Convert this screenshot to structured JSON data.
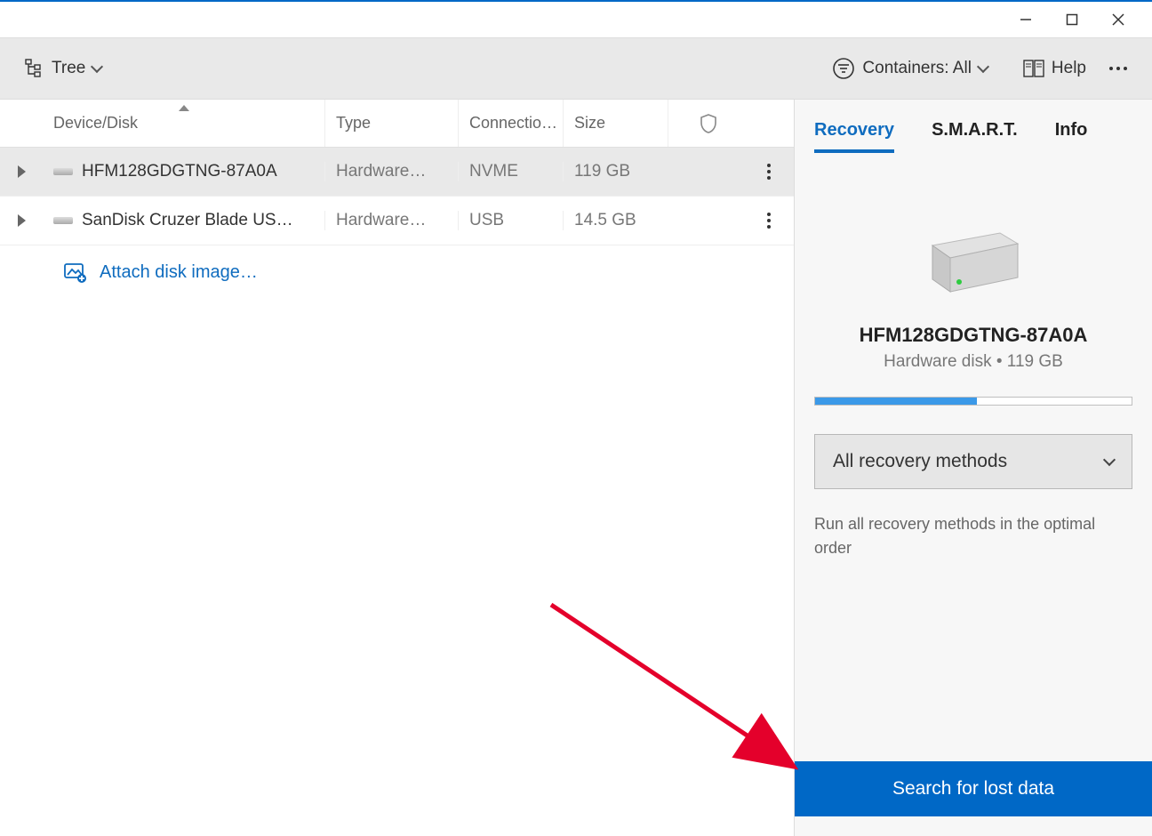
{
  "toolbar": {
    "view_label": "Tree",
    "containers_label": "Containers: All",
    "help_label": "Help"
  },
  "columns": {
    "device": "Device/Disk",
    "type": "Type",
    "connection": "Connectio…",
    "size": "Size"
  },
  "rows": [
    {
      "name": "HFM128GDGTNG-87A0A",
      "type": "Hardware…",
      "connection": "NVME",
      "size": "119 GB",
      "selected": true
    },
    {
      "name": "SanDisk Cruzer Blade US…",
      "type": "Hardware…",
      "connection": "USB",
      "size": "14.5 GB",
      "selected": false
    }
  ],
  "attach_label": "Attach disk image…",
  "tabs": {
    "recovery": "Recovery",
    "smart": "S.M.A.R.T.",
    "info": "Info"
  },
  "detail": {
    "title": "HFM128GDGTNG-87A0A",
    "subtitle": "Hardware disk • 119 GB",
    "usage_percent": 51,
    "method_label": "All recovery methods",
    "method_desc": "Run all recovery methods in the optimal order",
    "action_label": "Search for lost data"
  }
}
